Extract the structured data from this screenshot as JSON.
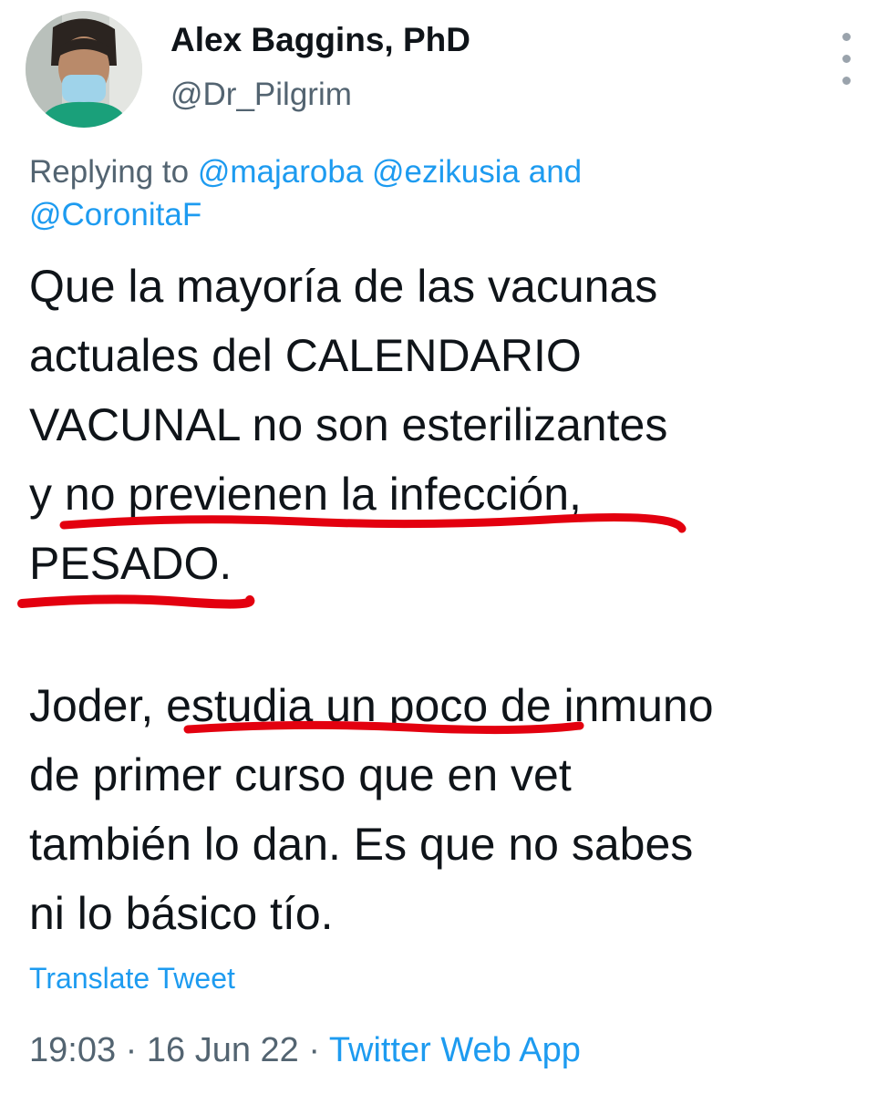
{
  "author": {
    "name": "Alex Baggins, PhD",
    "handle": "@Dr_Pilgrim"
  },
  "reply": {
    "prefix": "Replying to",
    "mentions": [
      "@majaroba",
      "@ezikusia"
    ],
    "conjunction": "and",
    "last_mention": "@CoronitaF"
  },
  "body": {
    "lines": [
      "Que la mayoría de las vacunas",
      "actuales del CALENDARIO",
      "VACUNAL no son esterilizantes",
      "y no previenen la infección,",
      "PESADO.",
      "Joder, estudia un poco de inmuno",
      "de primer curso que en vet",
      "también lo dan. Es que no sabes",
      "ni lo básico tío."
    ]
  },
  "translate_label": "Translate Tweet",
  "meta": {
    "time": "19:03",
    "separator": "·",
    "date": "16 Jun 22",
    "source": "Twitter Web App"
  },
  "icons": {
    "more": "more-vertical-icon",
    "avatar": "profile-photo"
  },
  "colors": {
    "text": "#0f1419",
    "secondary": "#536471",
    "link": "#1d9bf0",
    "annotation": "#e3000f"
  }
}
